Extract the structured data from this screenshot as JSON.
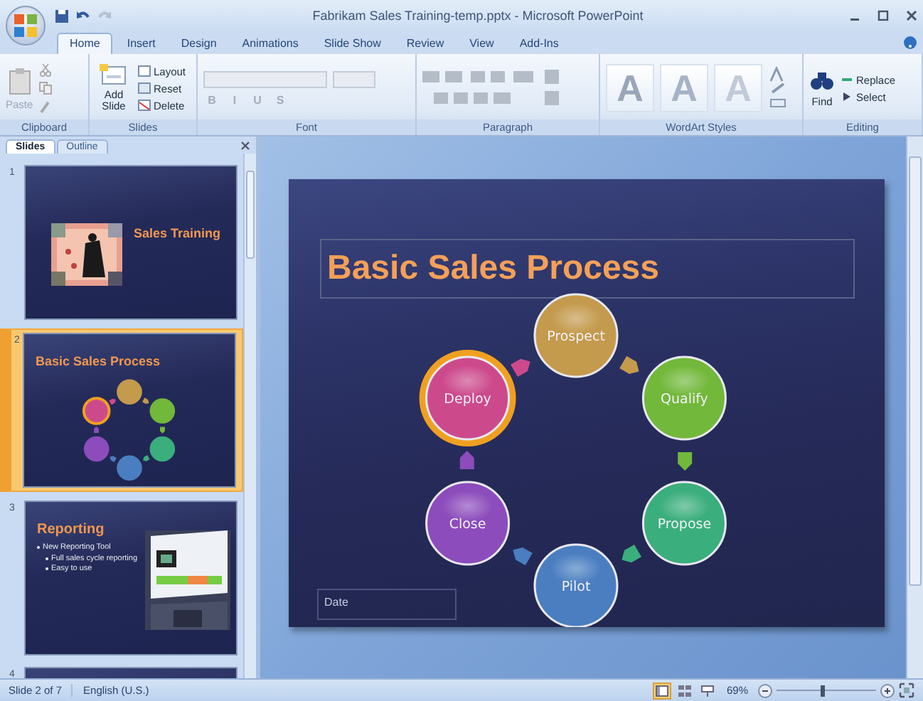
{
  "window": {
    "title": "Fabrikam Sales Training-temp.pptx - Microsoft PowerPoint"
  },
  "ribbon_tabs": [
    {
      "label": "Home",
      "selected": true
    },
    {
      "label": "Insert",
      "selected": false
    },
    {
      "label": "Design",
      "selected": false
    },
    {
      "label": "Animations",
      "selected": false
    },
    {
      "label": "Slide Show",
      "selected": false
    },
    {
      "label": "Review",
      "selected": false
    },
    {
      "label": "View",
      "selected": false
    },
    {
      "label": "Add-Ins",
      "selected": false
    }
  ],
  "ribbon": {
    "clipboard": {
      "label": "Clipboard",
      "paste": {
        "label": "Paste",
        "disabled": true
      }
    },
    "slides": {
      "label": "Slides",
      "add_slide": "Add Slide",
      "layout": "Layout",
      "reset": "Reset",
      "delete": "Delete"
    },
    "font": {
      "label": "Font",
      "disabled": true,
      "format_buttons": [
        "B",
        "I",
        "U",
        "S"
      ]
    },
    "paragraph": {
      "label": "Paragraph",
      "disabled": true
    },
    "wordart": {
      "label": "WordArt Styles",
      "styles": [
        "A",
        "A",
        "A"
      ]
    },
    "editing": {
      "label": "Editing",
      "find": "Find",
      "replace": "Replace",
      "select": "Select"
    }
  },
  "pane_tabs": [
    {
      "label": "Slides",
      "selected": true
    },
    {
      "label": "Outline",
      "selected": false
    }
  ],
  "thumbnails": [
    {
      "number": "1",
      "kind": "title",
      "title": "Sales Training",
      "selected": false
    },
    {
      "number": "2",
      "kind": "cycle",
      "title": "Basic Sales Process",
      "selected": true
    },
    {
      "number": "3",
      "kind": "bullets",
      "title": "Reporting",
      "bullets": [
        {
          "text": "New Reporting Tool",
          "children": [
            {
              "text": "Full sales cycle reporting"
            },
            {
              "text": "Easy to use"
            }
          ]
        }
      ],
      "selected": false
    },
    {
      "number": "4",
      "kind": "partial",
      "selected": false
    }
  ],
  "slide": {
    "title": "Basic Sales Process",
    "date_placeholder": "Date",
    "nodes": [
      {
        "label": "Prospect",
        "color": "#c49a4c",
        "selected": false
      },
      {
        "label": "Qualify",
        "color": "#72b83a",
        "selected": false
      },
      {
        "label": "Propose",
        "color": "#3aae7c",
        "selected": false
      },
      {
        "label": "Pilot",
        "color": "#4a7ec0",
        "selected": false
      },
      {
        "label": "Close",
        "color": "#8c4cbc",
        "selected": false
      },
      {
        "label": "Deploy",
        "color": "#cc4a8c",
        "selected": true
      }
    ]
  },
  "status_bar": {
    "slide_info": "Slide 2 of 7",
    "language": "English (U.S.)",
    "views": [
      {
        "kind": "normal",
        "selected": true
      },
      {
        "kind": "sorter",
        "selected": false
      },
      {
        "kind": "show",
        "selected": false
      }
    ],
    "zoom": "69%",
    "zoom_slider": {
      "level": 0.45
    }
  }
}
